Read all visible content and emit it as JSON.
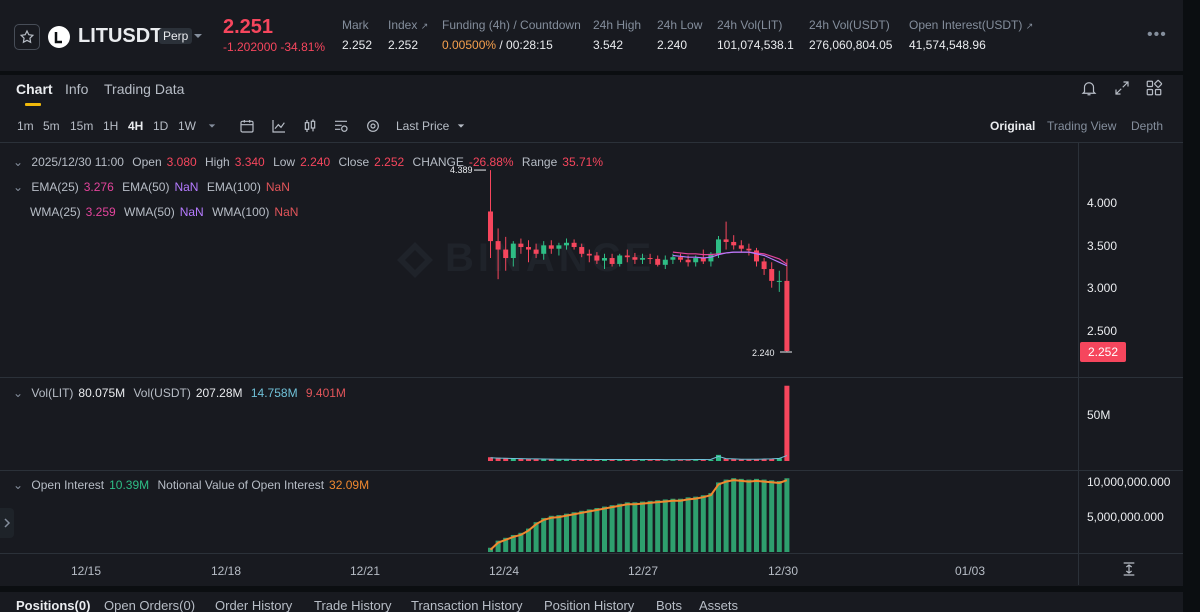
{
  "header": {
    "symbol": "LITUSDT",
    "contract_type": "Perp",
    "last_price": "2.251",
    "change_abs": "-1.202000",
    "change_pct": "-34.81%",
    "stats": [
      {
        "label": "Mark",
        "value": "2.252"
      },
      {
        "label": "Index",
        "value": "2.252"
      },
      {
        "label": "Funding (4h) / Countdown",
        "value_rate": "0.00500%",
        "value_countdown": "/ 00:28:15"
      },
      {
        "label": "24h High",
        "value": "3.542"
      },
      {
        "label": "24h Low",
        "value": "2.240"
      },
      {
        "label": "24h Vol(LIT)",
        "value": "101,074,538.1"
      },
      {
        "label": "24h Vol(USDT)",
        "value": "276,060,804.05"
      },
      {
        "label": "Open Interest(USDT)",
        "value": "41,574,548.96"
      }
    ]
  },
  "tabs": [
    "Chart",
    "Info",
    "Trading Data"
  ],
  "intervals": [
    "1m",
    "5m",
    "15m",
    "1H",
    "4H",
    "1D",
    "1W"
  ],
  "active_interval": "4H",
  "price_type": "Last Price",
  "views": [
    "Original",
    "Trading View",
    "Depth"
  ],
  "ohlc_legend": {
    "date": "2025/12/30 11:00",
    "open_label": "Open",
    "open": "3.080",
    "high_label": "High",
    "high": "3.340",
    "low_label": "Low",
    "low": "2.240",
    "close_label": "Close",
    "close": "2.252",
    "change_label": "CHANGE",
    "change": "-26.88%",
    "range_label": "Range",
    "range": "35.71%"
  },
  "ema_legend": {
    "ema25_label": "EMA(25)",
    "ema25": "3.276",
    "ema50_label": "EMA(50)",
    "ema50": "NaN",
    "ema100_label": "EMA(100)",
    "ema100": "NaN"
  },
  "wma_legend": {
    "wma25_label": "WMA(25)",
    "wma25": "3.259",
    "wma50_label": "WMA(50)",
    "wma50": "NaN",
    "wma100_label": "WMA(100)",
    "wma100": "NaN"
  },
  "vol_legend": {
    "vol_lit_label": "Vol(LIT)",
    "vol_lit": "80.075M",
    "vol_usdt_label": "Vol(USDT)",
    "vol_usdt": "207.28M",
    "ma1": "14.758M",
    "ma2": "9.401M"
  },
  "oi_legend": {
    "oi_label": "Open Interest",
    "oi": "10.39M",
    "notional_label": "Notional Value of Open Interest",
    "notional": "32.09M"
  },
  "watermark": "BINANCE",
  "price_axis": [
    "4.000",
    "3.500",
    "3.000",
    "2.500"
  ],
  "current_price_tag": "2.252",
  "high_marker": "4.389",
  "low_marker": "2.240",
  "vol_axis": [
    "50M"
  ],
  "oi_axis": [
    "10,000,000.000",
    "5,000,000.000"
  ],
  "time_axis": [
    "12/15",
    "12/18",
    "12/21",
    "12/24",
    "12/27",
    "12/30",
    "01/03"
  ],
  "bottom_tabs": [
    "Positions(0)",
    "Open Orders(0)",
    "Order History",
    "Trade History",
    "Transaction History",
    "Position History",
    "Bots",
    "Assets"
  ],
  "colors": {
    "up": "#2ebd85",
    "down": "#f6465d",
    "accent": "#f0b90b",
    "ema25": "#e2449b",
    "ema50": "#b57bff",
    "oi_line": "#f0882f"
  },
  "chart_data": [
    {
      "type": "candlestick",
      "title": "LITUSDT 4H",
      "x": [
        "12/24 00:00",
        "12/24 04:00",
        "12/24 08:00",
        "12/24 12:00",
        "12/24 16:00",
        "12/24 20:00",
        "12/25 00:00",
        "12/25 04:00",
        "12/25 08:00",
        "12/25 12:00",
        "12/25 16:00",
        "12/25 20:00",
        "12/26 00:00",
        "12/26 04:00",
        "12/26 08:00",
        "12/26 12:00",
        "12/26 16:00",
        "12/26 20:00",
        "12/27 00:00",
        "12/27 04:00",
        "12/27 08:00",
        "12/27 12:00",
        "12/27 16:00",
        "12/27 20:00",
        "12/28 00:00",
        "12/28 04:00",
        "12/28 08:00",
        "12/28 12:00",
        "12/28 16:00",
        "12/28 20:00",
        "12/29 00:00",
        "12/29 04:00",
        "12/29 08:00",
        "12/29 12:00",
        "12/29 16:00",
        "12/29 20:00",
        "12/30 00:00",
        "12/30 04:00",
        "12/30 08:00",
        "12/30 11:00"
      ],
      "open": [
        3.9,
        3.55,
        3.45,
        3.35,
        3.52,
        3.48,
        3.45,
        3.4,
        3.5,
        3.46,
        3.5,
        3.53,
        3.48,
        3.4,
        3.38,
        3.32,
        3.35,
        3.28,
        3.38,
        3.36,
        3.33,
        3.35,
        3.34,
        3.27,
        3.33,
        3.36,
        3.33,
        3.3,
        3.35,
        3.31,
        3.4,
        3.57,
        3.54,
        3.5,
        3.46,
        3.44,
        3.31,
        3.22,
        3.08,
        3.08
      ],
      "high": [
        4.389,
        3.7,
        3.6,
        3.55,
        3.58,
        3.56,
        3.52,
        3.55,
        3.56,
        3.53,
        3.58,
        3.57,
        3.52,
        3.45,
        3.42,
        3.4,
        3.4,
        3.4,
        3.45,
        3.41,
        3.4,
        3.4,
        3.38,
        3.38,
        3.4,
        3.4,
        3.38,
        3.38,
        3.45,
        3.42,
        3.61,
        3.78,
        3.62,
        3.56,
        3.52,
        3.47,
        3.35,
        3.3,
        3.2,
        3.34
      ],
      "low": [
        3.35,
        3.1,
        3.2,
        3.25,
        3.4,
        3.3,
        3.35,
        3.33,
        3.4,
        3.38,
        3.45,
        3.45,
        3.36,
        3.3,
        3.28,
        3.22,
        3.25,
        3.25,
        3.3,
        3.28,
        3.28,
        3.28,
        3.25,
        3.22,
        3.28,
        3.3,
        3.25,
        3.25,
        3.28,
        3.25,
        3.35,
        3.45,
        3.45,
        3.42,
        3.38,
        3.25,
        3.15,
        3.0,
        2.95,
        2.24
      ],
      "close": [
        3.55,
        3.45,
        3.35,
        3.52,
        3.48,
        3.45,
        3.4,
        3.5,
        3.46,
        3.5,
        3.53,
        3.48,
        3.4,
        3.38,
        3.32,
        3.35,
        3.28,
        3.38,
        3.36,
        3.33,
        3.35,
        3.34,
        3.27,
        3.33,
        3.36,
        3.33,
        3.3,
        3.35,
        3.31,
        3.4,
        3.57,
        3.54,
        3.5,
        3.46,
        3.44,
        3.31,
        3.22,
        3.08,
        3.08,
        2.252
      ],
      "ema25": [
        null,
        null,
        null,
        null,
        null,
        null,
        null,
        null,
        null,
        null,
        null,
        null,
        null,
        null,
        null,
        null,
        null,
        null,
        null,
        null,
        null,
        null,
        null,
        null,
        3.42,
        3.41,
        3.4,
        3.4,
        3.39,
        3.39,
        3.4,
        3.41,
        3.42,
        3.42,
        3.42,
        3.41,
        3.4,
        3.37,
        3.34,
        3.276
      ],
      "wma25": [
        null,
        null,
        null,
        null,
        null,
        null,
        null,
        null,
        null,
        null,
        null,
        null,
        null,
        null,
        null,
        null,
        null,
        null,
        null,
        null,
        null,
        null,
        null,
        null,
        3.38,
        3.37,
        3.36,
        3.36,
        3.35,
        3.36,
        3.39,
        3.41,
        3.42,
        3.42,
        3.42,
        3.4,
        3.38,
        3.34,
        3.3,
        3.259
      ],
      "ylim": [
        2.0,
        4.4
      ]
    },
    {
      "type": "bar",
      "title": "Vol(LIT)",
      "values_m": [
        4.0,
        3.5,
        3.2,
        2.8,
        2.5,
        2.2,
        2.0,
        1.8,
        1.6,
        1.5,
        1.4,
        1.3,
        1.2,
        1.2,
        1.1,
        1.1,
        1.0,
        1.0,
        1.0,
        0.9,
        0.9,
        0.9,
        0.9,
        0.8,
        0.8,
        0.8,
        0.8,
        0.9,
        1.0,
        1.2,
        6.5,
        2.5,
        2.0,
        1.5,
        1.4,
        1.5,
        1.8,
        2.2,
        3.0,
        80.075
      ],
      "ylim": [
        0,
        80
      ]
    },
    {
      "type": "bar",
      "title": "Open Interest",
      "values": [
        600000000.0,
        1600000000.0,
        2000000000.0,
        2400000000.0,
        2700000000.0,
        3300000000.0,
        4200000000.0,
        4800000000.0,
        5100000000.0,
        5200000000.0,
        5400000000.0,
        5600000000.0,
        5800000000.0,
        6000000000.0,
        6200000000.0,
        6400000000.0,
        6600000000.0,
        6800000000.0,
        7000000000.0,
        7000000000.0,
        7100000000.0,
        7200000000.0,
        7300000000.0,
        7400000000.0,
        7500000000.0,
        7500000000.0,
        7700000000.0,
        7800000000.0,
        8000000000.0,
        8300000000.0,
        9800000000.0,
        10200000000.0,
        10400000000.0,
        10300000000.0,
        10200000000.0,
        10300000000.0,
        10200000000.0,
        10100000000.0,
        10000000000.0,
        10390000000.0
      ],
      "ylim": [
        0,
        10500000000
      ]
    }
  ]
}
